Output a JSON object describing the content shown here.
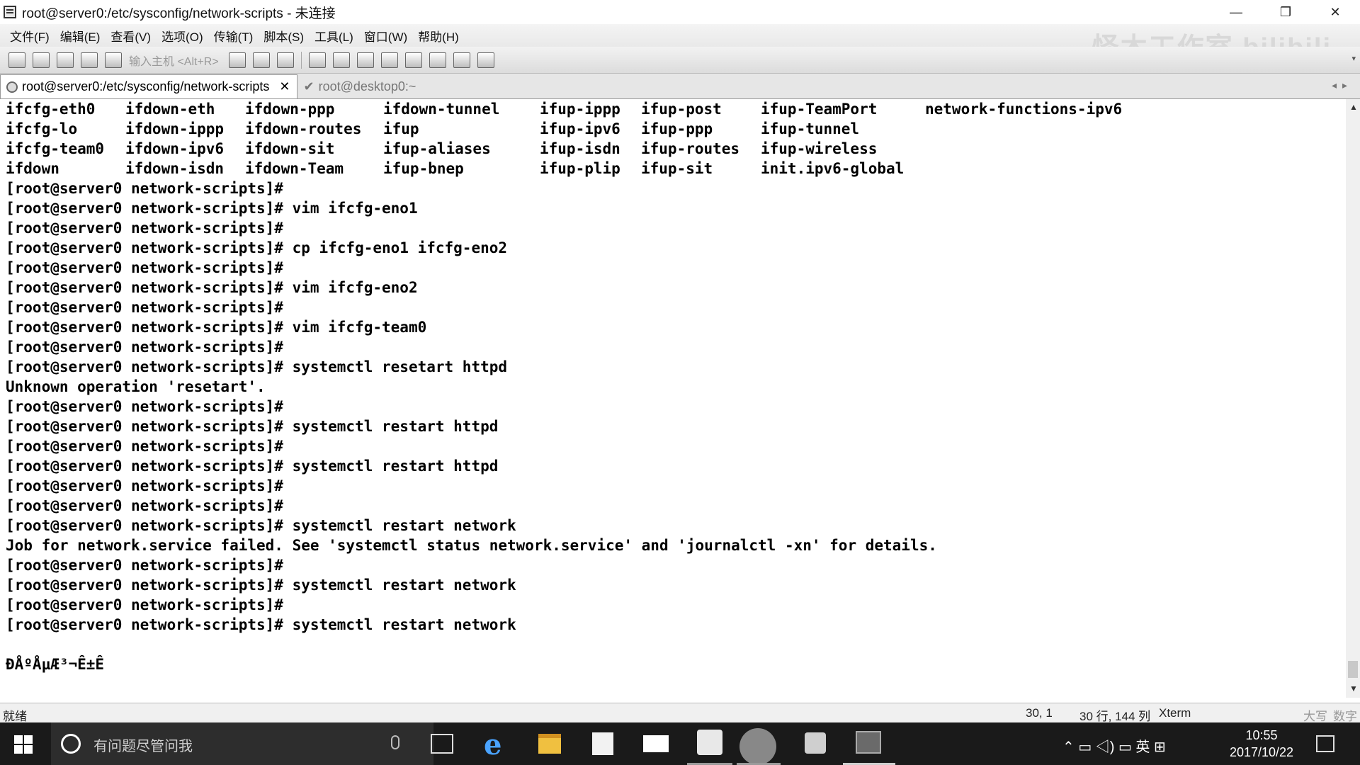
{
  "window": {
    "title": "root@server0:/etc/sysconfig/network-scripts - 未连接",
    "controls": [
      "—",
      "❐",
      "✕"
    ]
  },
  "menu": [
    "文件(F)",
    "编辑(E)",
    "查看(V)",
    "选项(O)",
    "传输(T)",
    "脚本(S)",
    "工具(L)",
    "窗口(W)",
    "帮助(H)"
  ],
  "watermark": "怪木工作室 bilibili",
  "toolbar": {
    "host_input_placeholder": "输入主机 <Alt+R>"
  },
  "tabs": [
    {
      "label": "root@server0:/etc/sysconfig/network-scripts",
      "active": true,
      "close": "✕"
    },
    {
      "label": "root@desktop0:~",
      "active": false
    }
  ],
  "terminal": {
    "ls_rows": [
      [
        "ifcfg-eth0",
        "ifdown-eth",
        "ifdown-ppp",
        "ifdown-tunnel",
        "ifup-ippp",
        "ifup-post",
        "ifup-TeamPort",
        "network-functions-ipv6"
      ],
      [
        "ifcfg-lo",
        "ifdown-ippp",
        "ifdown-routes",
        "ifup",
        "ifup-ipv6",
        "ifup-ppp",
        "ifup-tunnel",
        ""
      ],
      [
        "ifcfg-team0",
        "ifdown-ipv6",
        "ifdown-sit",
        "ifup-aliases",
        "ifup-isdn",
        "ifup-routes",
        "ifup-wireless",
        ""
      ],
      [
        "ifdown",
        "ifdown-isdn",
        "ifdown-Team",
        "ifup-bnep",
        "ifup-plip",
        "ifup-sit",
        "init.ipv6-global",
        ""
      ]
    ],
    "lines": [
      "[root@server0 network-scripts]#",
      "[root@server0 network-scripts]# vim ifcfg-eno1",
      "[root@server0 network-scripts]#",
      "[root@server0 network-scripts]# cp ifcfg-eno1 ifcfg-eno2",
      "[root@server0 network-scripts]#",
      "[root@server0 network-scripts]# vim ifcfg-eno2",
      "[root@server0 network-scripts]#",
      "[root@server0 network-scripts]# vim ifcfg-team0",
      "[root@server0 network-scripts]#",
      "[root@server0 network-scripts]# systemctl resetart httpd",
      "Unknown operation 'resetart'.",
      "[root@server0 network-scripts]#",
      "[root@server0 network-scripts]# systemctl restart httpd",
      "[root@server0 network-scripts]#",
      "[root@server0 network-scripts]# systemctl restart httpd",
      "[root@server0 network-scripts]#",
      "[root@server0 network-scripts]#",
      "[root@server0 network-scripts]# systemctl restart network",
      "Job for network.service failed. See 'systemctl status network.service' and 'journalctl -xn' for details.",
      "[root@server0 network-scripts]#",
      "[root@server0 network-scripts]# systemctl restart network",
      "[root@server0 network-scripts]#",
      "[root@server0 network-scripts]# systemctl restart network",
      "",
      "ÐÅºÅµÆ³¬Ê±Ê"
    ]
  },
  "statusbar": {
    "ready": "就绪",
    "cursor": "30,  1",
    "size": "30 行, 144 列",
    "term_type": "Xterm",
    "caps": "大写",
    "num": "数字"
  },
  "taskbar": {
    "search_placeholder": "有问题尽管问我",
    "tray": "⌃  ▭  ◁)  ▭  英  ⊞",
    "time": "10:55",
    "date": "2017/10/22"
  }
}
